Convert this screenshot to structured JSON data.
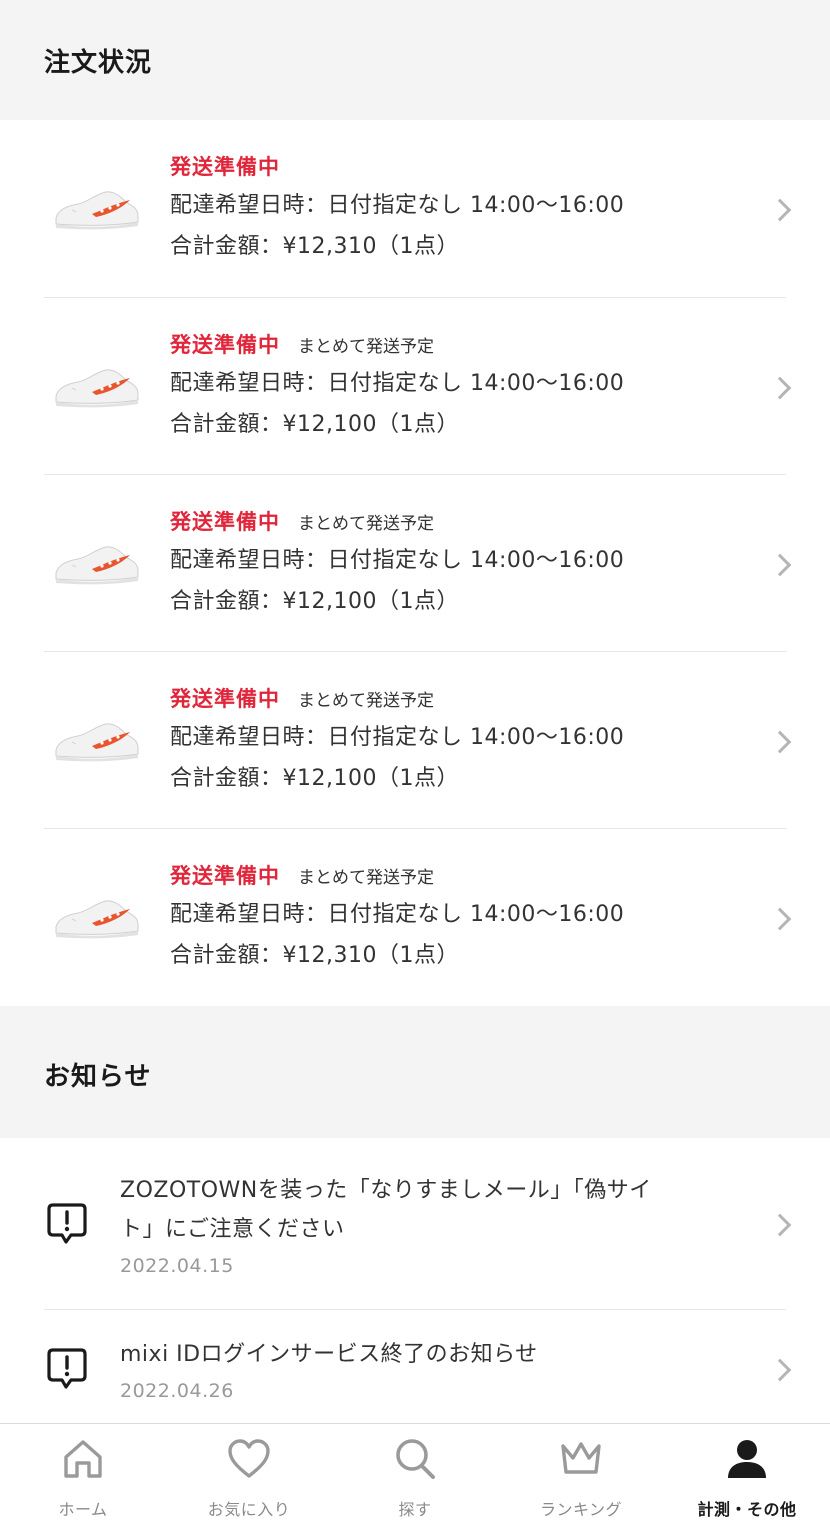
{
  "order_section": {
    "title": "注文状況"
  },
  "orders": [
    {
      "status": "発送準備中",
      "note": "",
      "delivery": "配達希望日時：日付指定なし 14:00〜16:00",
      "total": "合計金額：¥12,310（1点）"
    },
    {
      "status": "発送準備中",
      "note": "まとめて発送予定",
      "delivery": "配達希望日時：日付指定なし 14:00〜16:00",
      "total": "合計金額：¥12,100（1点）"
    },
    {
      "status": "発送準備中",
      "note": "まとめて発送予定",
      "delivery": "配達希望日時：日付指定なし 14:00〜16:00",
      "total": "合計金額：¥12,100（1点）"
    },
    {
      "status": "発送準備中",
      "note": "まとめて発送予定",
      "delivery": "配達希望日時：日付指定なし 14:00〜16:00",
      "total": "合計金額：¥12,100（1点）"
    },
    {
      "status": "発送準備中",
      "note": "まとめて発送予定",
      "delivery": "配達希望日時：日付指定なし 14:00〜16:00",
      "total": "合計金額：¥12,310（1点）"
    }
  ],
  "news_section": {
    "title": "お知らせ"
  },
  "news": [
    {
      "title_line1": "ZOZOTOWNを装った「なりすましメール」「偽サイ",
      "title_line2": "ト」にご注意ください",
      "date": "2022.04.15",
      "icon": "alert-bubble-icon"
    },
    {
      "title_line1": "mixi IDログインサービス終了のお知らせ",
      "title_line2": "",
      "date": "2022.04.26",
      "icon": "alert-bubble-icon"
    }
  ],
  "tabbar": [
    {
      "label": "ホーム",
      "icon": "home-icon",
      "active": false
    },
    {
      "label": "お気に入り",
      "icon": "heart-icon",
      "active": false
    },
    {
      "label": "探す",
      "icon": "search-icon",
      "active": false
    },
    {
      "label": "ランキング",
      "icon": "crown-icon",
      "active": false
    },
    {
      "label": "計測・その他",
      "icon": "person-icon",
      "active": true
    }
  ],
  "colors": {
    "status_red": "#e0263b",
    "background": "#f4f4f4",
    "shoe_accent": "#e8552e"
  }
}
